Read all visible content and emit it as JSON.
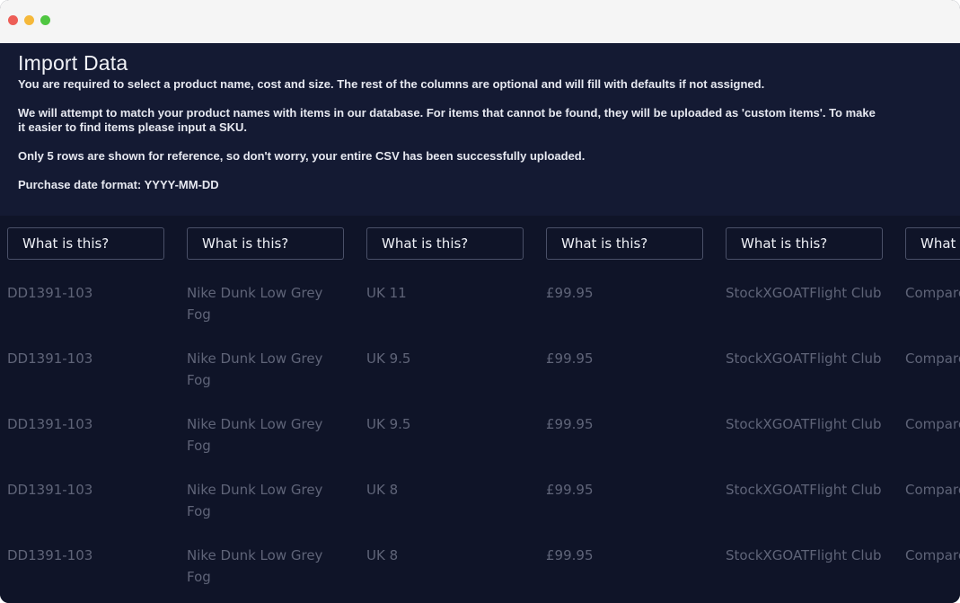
{
  "info": {
    "title": "Import Data",
    "line1": "You are required to select a product name, cost and size. The rest of the columns are optional and will fill with defaults if not assigned.",
    "line2a": "We will attempt to match your product names with items in our database. For items that cannot be found, they will be uploaded as 'custom items'. To make",
    "line2b": "it easier to find items please input a SKU.",
    "line3": "Only 5 rows are shown for reference, so don't worry, your entire CSV has been successfully uploaded.",
    "line4": "Purchase date format: YYYY-MM-DD"
  },
  "columns": [
    {
      "select": "What is this?",
      "cells": [
        "DD1391-103",
        "DD1391-103",
        "DD1391-103",
        "DD1391-103",
        "DD1391-103"
      ]
    },
    {
      "select": "What is this?",
      "cells": [
        "Nike Dunk Low Grey Fog",
        "Nike Dunk Low Grey Fog",
        "Nike Dunk Low Grey Fog",
        "Nike Dunk Low Grey Fog",
        "Nike Dunk Low Grey Fog"
      ]
    },
    {
      "select": "What is this?",
      "cells": [
        "UK 11",
        "UK 9.5",
        "UK 9.5",
        "UK 8",
        "UK 8"
      ]
    },
    {
      "select": "What is this?",
      "cells": [
        "£99.95",
        "£99.95",
        "£99.95",
        "£99.95",
        "£99.95"
      ]
    },
    {
      "select": "What is this?",
      "cells": [
        "StockXGOATFlight Club",
        "StockXGOATFlight Club",
        "StockXGOATFlight Club",
        "StockXGOATFlight Club",
        "StockXGOATFlight Club"
      ]
    },
    {
      "select": "What is this?",
      "cells": [
        "Compare",
        "Compare",
        "Compare",
        "Compare",
        "Compare"
      ]
    }
  ]
}
